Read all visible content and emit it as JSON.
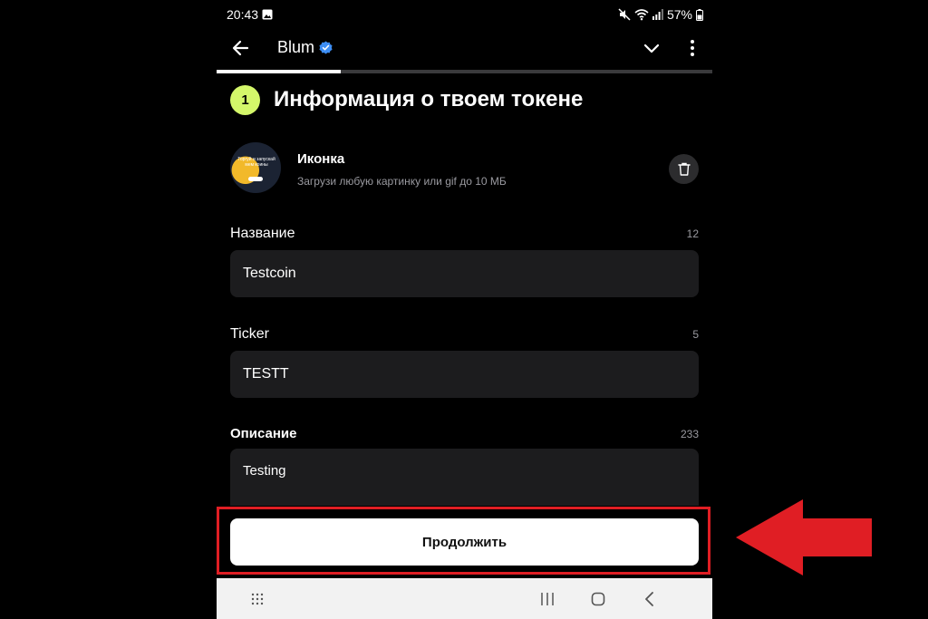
{
  "status_bar": {
    "time": "20:43",
    "battery": "57%",
    "icons": [
      "gallery-icon",
      "mute-icon",
      "wifi-icon",
      "signal-icon",
      "battery-icon"
    ]
  },
  "header": {
    "title": "Blum",
    "verified_color": "#3d8ef5",
    "icons": [
      "back-arrow-icon",
      "chevron-down-icon",
      "more-vert-icon"
    ]
  },
  "progress": {
    "value": 0.25
  },
  "section": {
    "step_number": "1",
    "title": "Информация о твоем токене",
    "step_badge_color": "#d4f76a"
  },
  "token_icon": {
    "avatar_text": "Торгуй и запускай мем коины",
    "label": "Иконка",
    "hint": "Загрузи любую картинку или gif до 10 МБ",
    "delete_icon": "trash-icon"
  },
  "fields": {
    "name": {
      "label": "Название",
      "counter": "12",
      "value": "Testcoin"
    },
    "ticker": {
      "label": "Ticker",
      "counter": "5",
      "value": "TESTT"
    },
    "description": {
      "label": "Описание",
      "counter": "233",
      "value": "Testing"
    }
  },
  "continue_button": {
    "label": "Продолжить"
  },
  "annotation": {
    "highlight_color": "#e01e24",
    "arrow_color": "#e01e24"
  },
  "nav_bar": {
    "items": [
      "apps-grid-icon",
      "recent-apps-icon",
      "home-icon",
      "back-icon"
    ]
  }
}
